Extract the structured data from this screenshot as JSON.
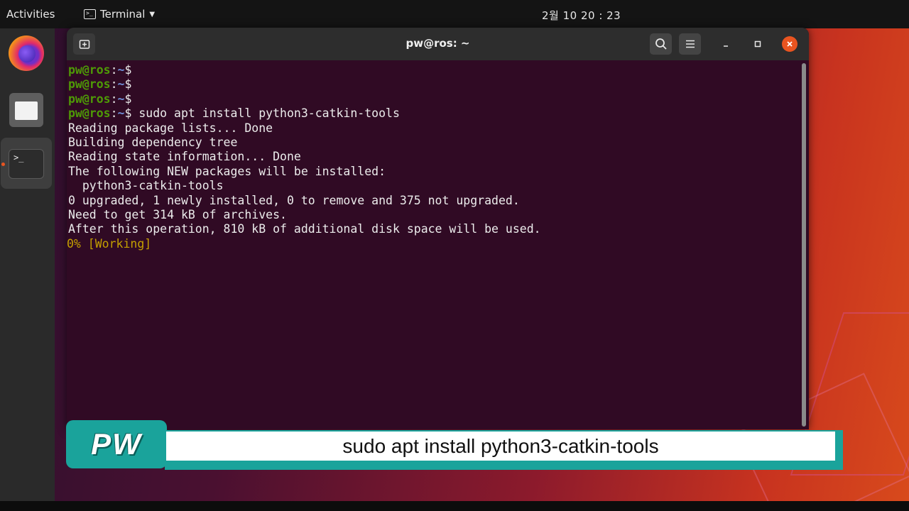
{
  "topbar": {
    "activities_label": "Activities",
    "app_menu_label": "Terminal",
    "app_menu_icon": "terminal-icon",
    "clock": "2월 10  20 : 23"
  },
  "dock": {
    "items": [
      {
        "name": "Firefox",
        "icon": "firefox-icon"
      },
      {
        "name": "Files",
        "icon": "folder-icon"
      },
      {
        "name": "Terminal",
        "icon": "terminal-icon",
        "running": true
      }
    ]
  },
  "window": {
    "title": "pw@ros: ~",
    "close_color": "#e95420",
    "background_color": "#300a24"
  },
  "terminal": {
    "prompt_user": "pw@ros",
    "prompt_path": "~",
    "prompt_symbol": "$",
    "empty_prompts": 3,
    "command": "sudo apt install python3-catkin-tools",
    "output": [
      "Reading package lists... Done",
      "Building dependency tree",
      "Reading state information... Done",
      "The following NEW packages will be installed:",
      "  python3-catkin-tools",
      "0 upgraded, 1 newly installed, 0 to remove and 375 not upgraded.",
      "Need to get 314 kB of archives.",
      "After this operation, 810 kB of additional disk space will be used."
    ],
    "progress_line": "0% [Working]"
  },
  "caption": {
    "logo_text": "PW",
    "text": "sudo apt install python3-catkin-tools",
    "accent_color": "#1aa39b"
  }
}
